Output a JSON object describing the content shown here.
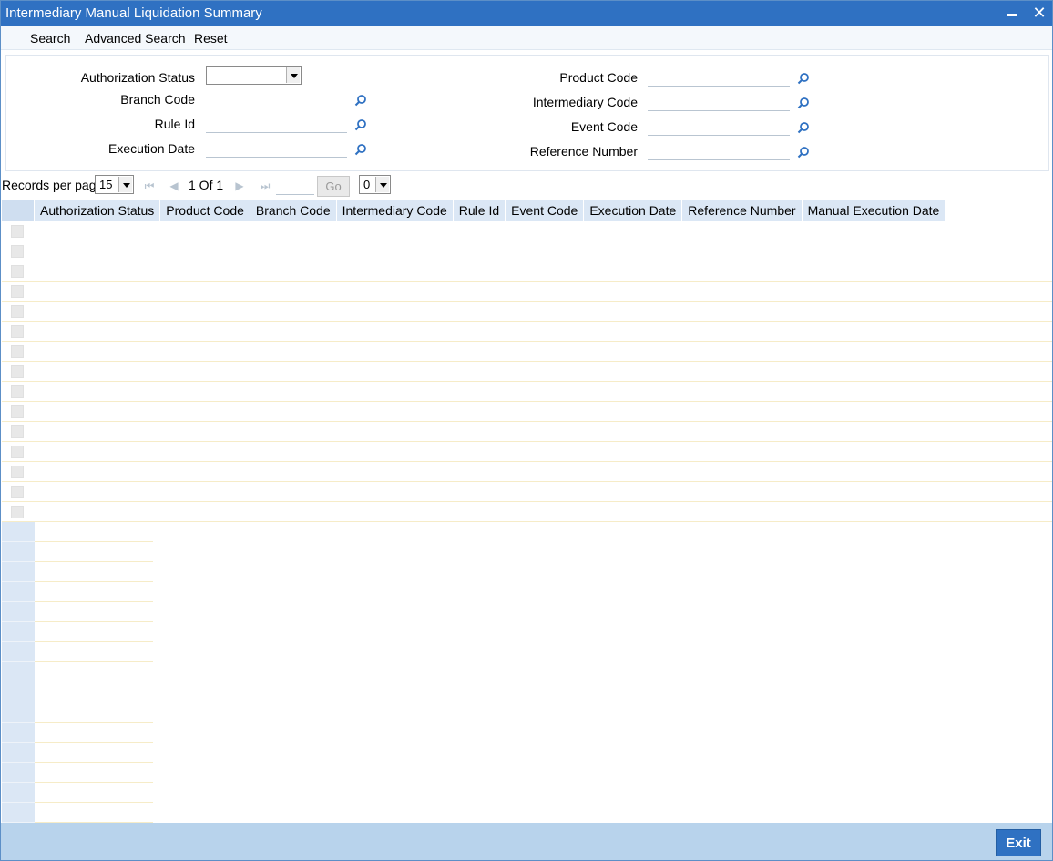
{
  "window": {
    "title": "Intermediary Manual Liquidation Summary"
  },
  "toolbar": {
    "search": "Search",
    "advanced_search": "Advanced Search",
    "reset": "Reset"
  },
  "criteria": {
    "authorization_status": {
      "label": "Authorization Status",
      "value": ""
    },
    "branch_code": {
      "label": "Branch Code",
      "value": ""
    },
    "rule_id": {
      "label": "Rule Id",
      "value": ""
    },
    "execution_date": {
      "label": "Execution Date",
      "value": ""
    },
    "product_code": {
      "label": "Product Code",
      "value": ""
    },
    "intermediary_code": {
      "label": "Intermediary Code",
      "value": ""
    },
    "event_code": {
      "label": "Event Code",
      "value": ""
    },
    "reference_number": {
      "label": "Reference Number",
      "value": ""
    }
  },
  "pager": {
    "records_per_page_label": "Records per page",
    "records_per_page": "15",
    "page_info": "1 Of 1",
    "go": "Go",
    "extra_select": "0"
  },
  "grid": {
    "columns": [
      "Authorization Status",
      "Product Code",
      "Branch Code",
      "Intermediary Code",
      "Rule Id",
      "Event Code",
      "Execution Date",
      "Reference Number",
      "Manual Execution Date"
    ],
    "rows": []
  },
  "footer": {
    "exit": "Exit"
  },
  "colors": {
    "titlebar": "#2f71c2",
    "header": "#dbe7f5",
    "footer": "#b8d3ec",
    "exit_button": "#2f71c2"
  },
  "icons": {
    "lookup": "search-icon",
    "minimize": "minimize-icon",
    "close": "close-icon"
  }
}
